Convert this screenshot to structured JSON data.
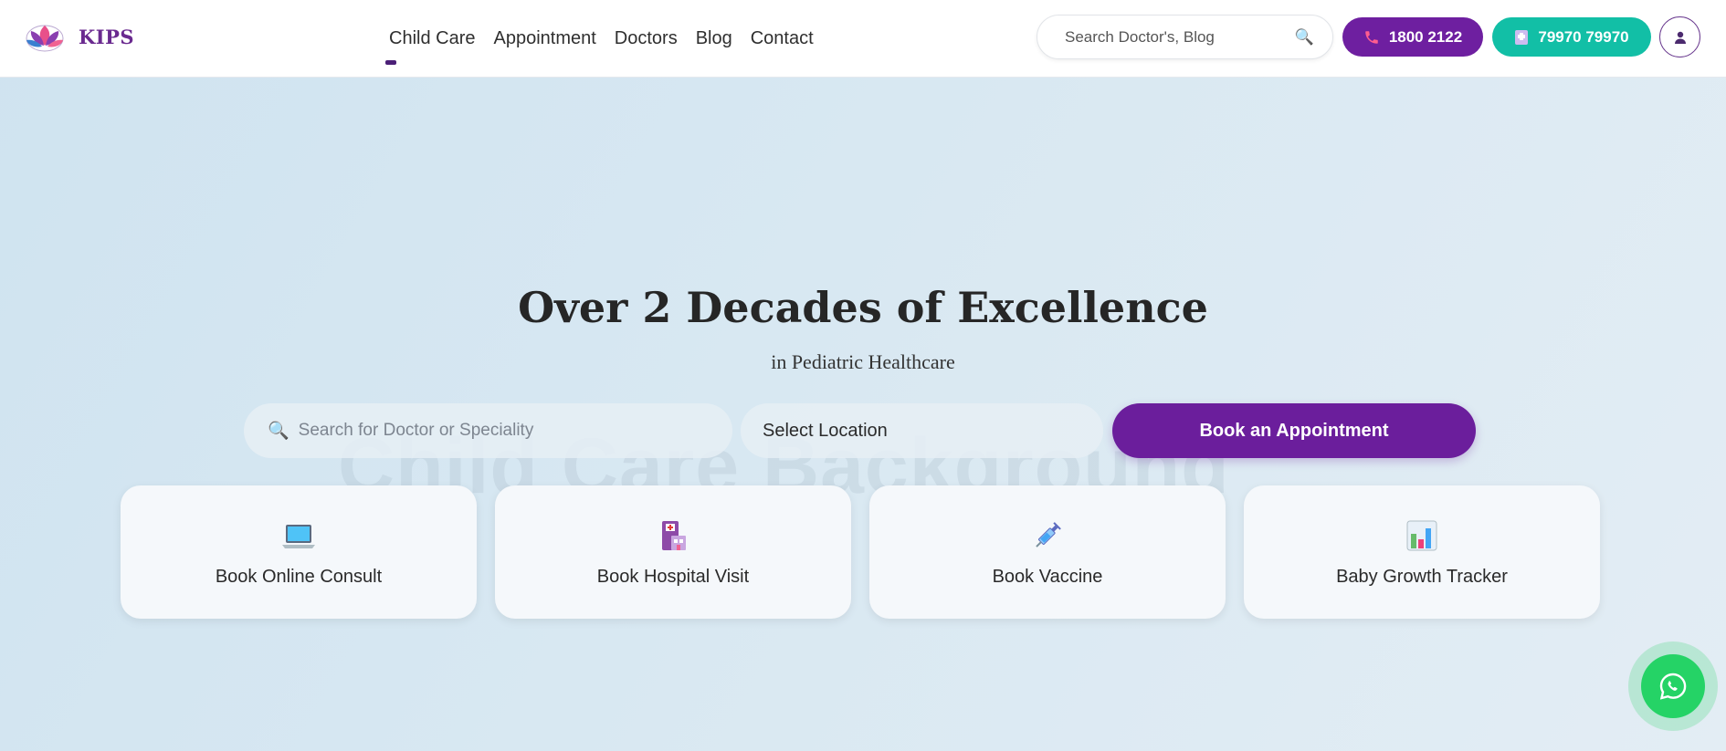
{
  "brand": {
    "name": "KIPS"
  },
  "nav": {
    "links": [
      {
        "label": "Child Care",
        "active": true
      },
      {
        "label": "Appointment"
      },
      {
        "label": "Doctors"
      },
      {
        "label": "Blog"
      },
      {
        "label": "Contact"
      }
    ],
    "search_placeholder": "Search Doctor's, Blog",
    "phone_label": "1800 2122",
    "mobile_label": "79970 79970"
  },
  "hero": {
    "watermark": "Child Care Background",
    "title": "Over 2 Decades of Excellence",
    "subtitle": "in Pediatric Healthcare",
    "search_placeholder": "Search for Doctor or Speciality",
    "location_label": "Select Location",
    "book_label": "Book an Appointment"
  },
  "cards": [
    {
      "label": "Book Online Consult",
      "icon": "laptop-icon"
    },
    {
      "label": "Book Hospital Visit",
      "icon": "hospital-icon"
    },
    {
      "label": "Book Vaccine",
      "icon": "syringe-icon"
    },
    {
      "label": "Baby Growth Tracker",
      "icon": "bar-chart-icon"
    }
  ],
  "colors": {
    "primary": "#6b1e9c",
    "teal": "#12bfa6",
    "whatsapp": "#25d366"
  }
}
